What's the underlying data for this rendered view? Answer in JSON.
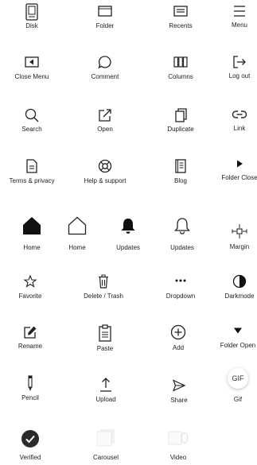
{
  "icons": [
    {
      "label": "Disk",
      "icon": "disk-icon"
    },
    {
      "label": "Folder",
      "icon": "folder-icon"
    },
    {
      "label": "Recents",
      "icon": "recents-icon"
    },
    {
      "label": "Menu",
      "icon": "menu-icon"
    },
    {
      "label": "Close Menu",
      "icon": "close-menu-icon"
    },
    {
      "label": "Comment",
      "icon": "comment-icon"
    },
    {
      "label": "Columns",
      "icon": "columns-icon"
    },
    {
      "label": "Log out",
      "icon": "log-out-icon"
    },
    {
      "label": "Search",
      "icon": "search-icon"
    },
    {
      "label": "Open",
      "icon": "open-icon"
    },
    {
      "label": "Duplicate",
      "icon": "duplicate-icon"
    },
    {
      "label": "Link",
      "icon": "link-icon"
    },
    {
      "label": "Terms & privacy",
      "icon": "document-icon"
    },
    {
      "label": "Help & support",
      "icon": "lifebuoy-icon"
    },
    {
      "label": "Blog",
      "icon": "notebook-icon"
    },
    {
      "label": "Folder Close",
      "icon": "caret-right-icon"
    },
    {
      "label": "Home",
      "icon": "home-filled-icon"
    },
    {
      "label": "Home",
      "icon": "home-outline-icon"
    },
    {
      "label": "Updates",
      "icon": "bell-filled-icon"
    },
    {
      "label": "Updates",
      "icon": "bell-outline-icon"
    },
    {
      "label": "Margin",
      "icon": "margin-icon"
    },
    {
      "label": "Favorite",
      "icon": "star-icon"
    },
    {
      "label": "Delete / Trash",
      "icon": "trash-icon"
    },
    {
      "label": "Dropdown",
      "icon": "ellipsis-icon"
    },
    {
      "label": "Darkmode",
      "icon": "darkmode-icon"
    },
    {
      "label": "Rename",
      "icon": "rename-icon"
    },
    {
      "label": "Paste",
      "icon": "paste-icon"
    },
    {
      "label": "Add",
      "icon": "add-icon"
    },
    {
      "label": "Folder Open",
      "icon": "caret-down-icon"
    },
    {
      "label": "Pencil",
      "icon": "pencil-icon"
    },
    {
      "label": "Upload",
      "icon": "upload-icon"
    },
    {
      "label": "Share",
      "icon": "share-icon"
    },
    {
      "label": "Gif",
      "icon": "gif-icon",
      "badge": "GIF"
    },
    {
      "label": "Verified",
      "icon": "verified-icon"
    },
    {
      "label": "Carousel",
      "icon": "carousel-icon"
    },
    {
      "label": "Video",
      "icon": "video-icon"
    }
  ]
}
